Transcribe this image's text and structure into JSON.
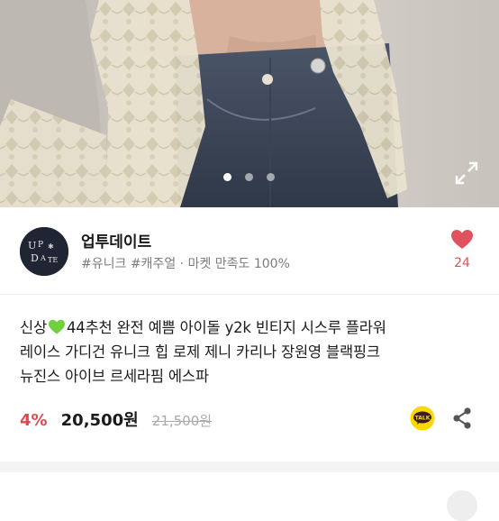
{
  "gallery": {
    "total_images": 3,
    "active_index": 0,
    "expand_icon": "expand-arrows-icon"
  },
  "seller": {
    "name": "업투데이트",
    "avatar_text": "UP DATE",
    "tags": [
      "#유니크",
      "#캐주얼"
    ],
    "separator": "·",
    "satisfaction": "마켓 만족도 100%",
    "like_icon": "heart-icon",
    "like_count": "24"
  },
  "product": {
    "title_line1_a": "신상",
    "title_line1_b": "44추천 완전 예쁨 아이돌 y2k 빈티지 시스루 플라워",
    "title_line2": "레이스 가디건 유니크 힙 로제 제니 카리나 장원영 블랙핑크",
    "title_line3": "뉴진스 아이브 르세라핌 에스파",
    "discount": "4%",
    "price": "20,500원",
    "original_price": "21,500원",
    "talk_label": "TALK",
    "share_icon": "share-icon"
  },
  "colors": {
    "accent_red": "#e2474f",
    "heart_pink": "#e0525e",
    "talk_yellow": "#f9d900"
  }
}
